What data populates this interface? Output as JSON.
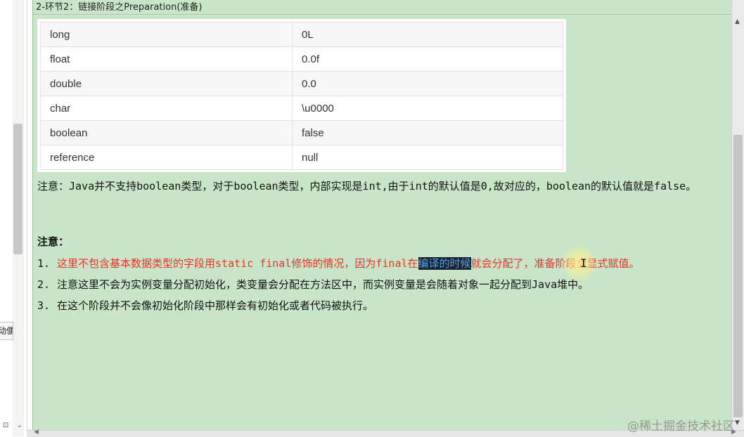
{
  "left_pane": {
    "tab_text": "动便",
    "bottom_icons": "⊡ ⌄"
  },
  "title_bar": {
    "title": "2-环节2：链接阶段之Preparation(准备)"
  },
  "table": {
    "rows": [
      {
        "type": "long",
        "default": "0L"
      },
      {
        "type": "float",
        "default": "0.0f"
      },
      {
        "type": "double",
        "default": "0.0"
      },
      {
        "type": "char",
        "default": "\\u0000"
      },
      {
        "type": "boolean",
        "default": "false"
      },
      {
        "type": "reference",
        "default": "null"
      }
    ]
  },
  "note1": "注意：Java并不支持boolean类型，对于boolean类型，内部实现是int,由于int的默认值是0,故对应的，boolean的默认值就是false。",
  "note_heading": "注意：",
  "list": [
    {
      "num": "1.",
      "before": "这里不包含基本数据类型的字段用static final修饰的情况，因为final在",
      "highlight": "编译的时候",
      "after": "就会分配了，准备阶段会显式赋值。"
    },
    {
      "num": "2.",
      "text": "注意这里不会为实例变量分配初始化，类变量会分配在方法区中，而实例变量是会随着对象一起分配到Java堆中。"
    },
    {
      "num": "3.",
      "text": "在这个阶段并不会像初始化阶段中那样会有初始化或者代码被执行。"
    }
  ],
  "cursor_glyph": "I",
  "watermark": "@稀土掘金技术社区",
  "colors": {
    "background": "#c9e5c8",
    "red_text": "#e8322b",
    "highlight_bg": "#1b1f2e",
    "highlight_fg": "#4ba6e8"
  }
}
